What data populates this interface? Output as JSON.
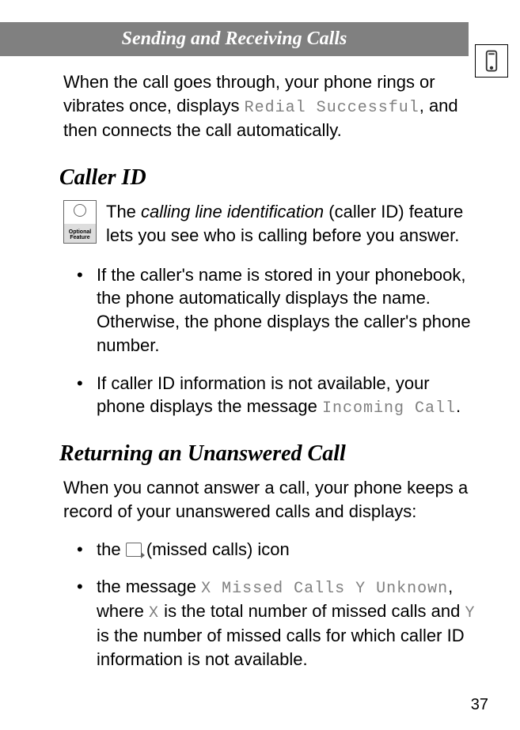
{
  "header": {
    "title": "Sending and Receiving Calls"
  },
  "intro": {
    "pre": "When the call goes through, your phone rings or vibrates once, displays ",
    "code": "Redial Successful",
    "post": ", and then connects the call automatically."
  },
  "section_caller_id": {
    "heading": "Caller ID",
    "feature_pre": "The ",
    "feature_em": "calling line identification",
    "feature_post": " (caller ID) feature lets you see who is calling before you answer.",
    "bullets": [
      {
        "text": "If the caller's name is stored in your phonebook, the phone automatically displays the name. Otherwise, the phone displays the caller's phone number."
      },
      {
        "pre": "If caller ID information is not available, your phone displays the message ",
        "code": "Incoming Call",
        "post": "."
      }
    ],
    "icon_label": "Optional\nFeature"
  },
  "section_returning": {
    "heading": "Returning an Unanswered Call",
    "intro": "When you cannot answer a call, your phone keeps a record of your unanswered calls and displays:",
    "bullets": [
      {
        "pre": "the ",
        "post": " (missed calls) icon"
      },
      {
        "pre": "the message ",
        "code": "X Missed Calls Y Unknown",
        "mid": ", where ",
        "codeX": "X",
        "mid2": " is the total number of missed calls and ",
        "codeY": "Y",
        "post": " is the number of missed calls for which caller ID information is not available."
      }
    ]
  },
  "page_number": "37"
}
